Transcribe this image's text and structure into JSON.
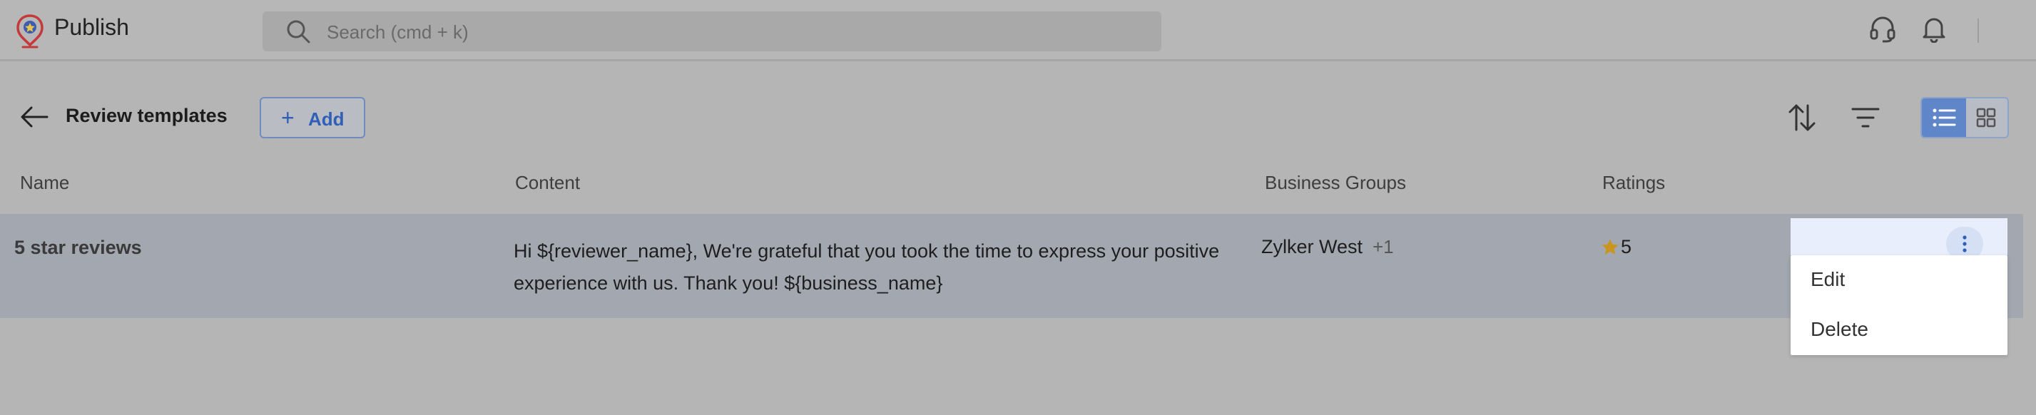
{
  "app": {
    "title": "Publish"
  },
  "search": {
    "placeholder": "Search (cmd + k)"
  },
  "header_icons": [
    "headset-icon",
    "bell-icon"
  ],
  "toolbar": {
    "title": "Review templates",
    "add_label": "Add",
    "add_icon": "+",
    "icons": [
      "back-arrow-icon",
      "sort-icon",
      "filter-icon",
      "list-view-icon",
      "grid-view-icon"
    ],
    "active_view": "list"
  },
  "table": {
    "columns": [
      "Name",
      "Content",
      "Business Groups",
      "Ratings"
    ],
    "rows": [
      {
        "name": "5 star reviews",
        "content": "Hi ${reviewer_name}, We're grateful that you took the time to express your positive experience with us. Thank you! ${business_name}",
        "group": "Zylker West",
        "group_more": "+1",
        "rating": "5"
      }
    ]
  },
  "row_menu": {
    "items": [
      "Edit",
      "Delete"
    ]
  },
  "colors": {
    "accent": "#2f5fb6",
    "active_toggle": "#5e86c8",
    "star": "#c9951c",
    "logo_red": "#c43a3a"
  }
}
